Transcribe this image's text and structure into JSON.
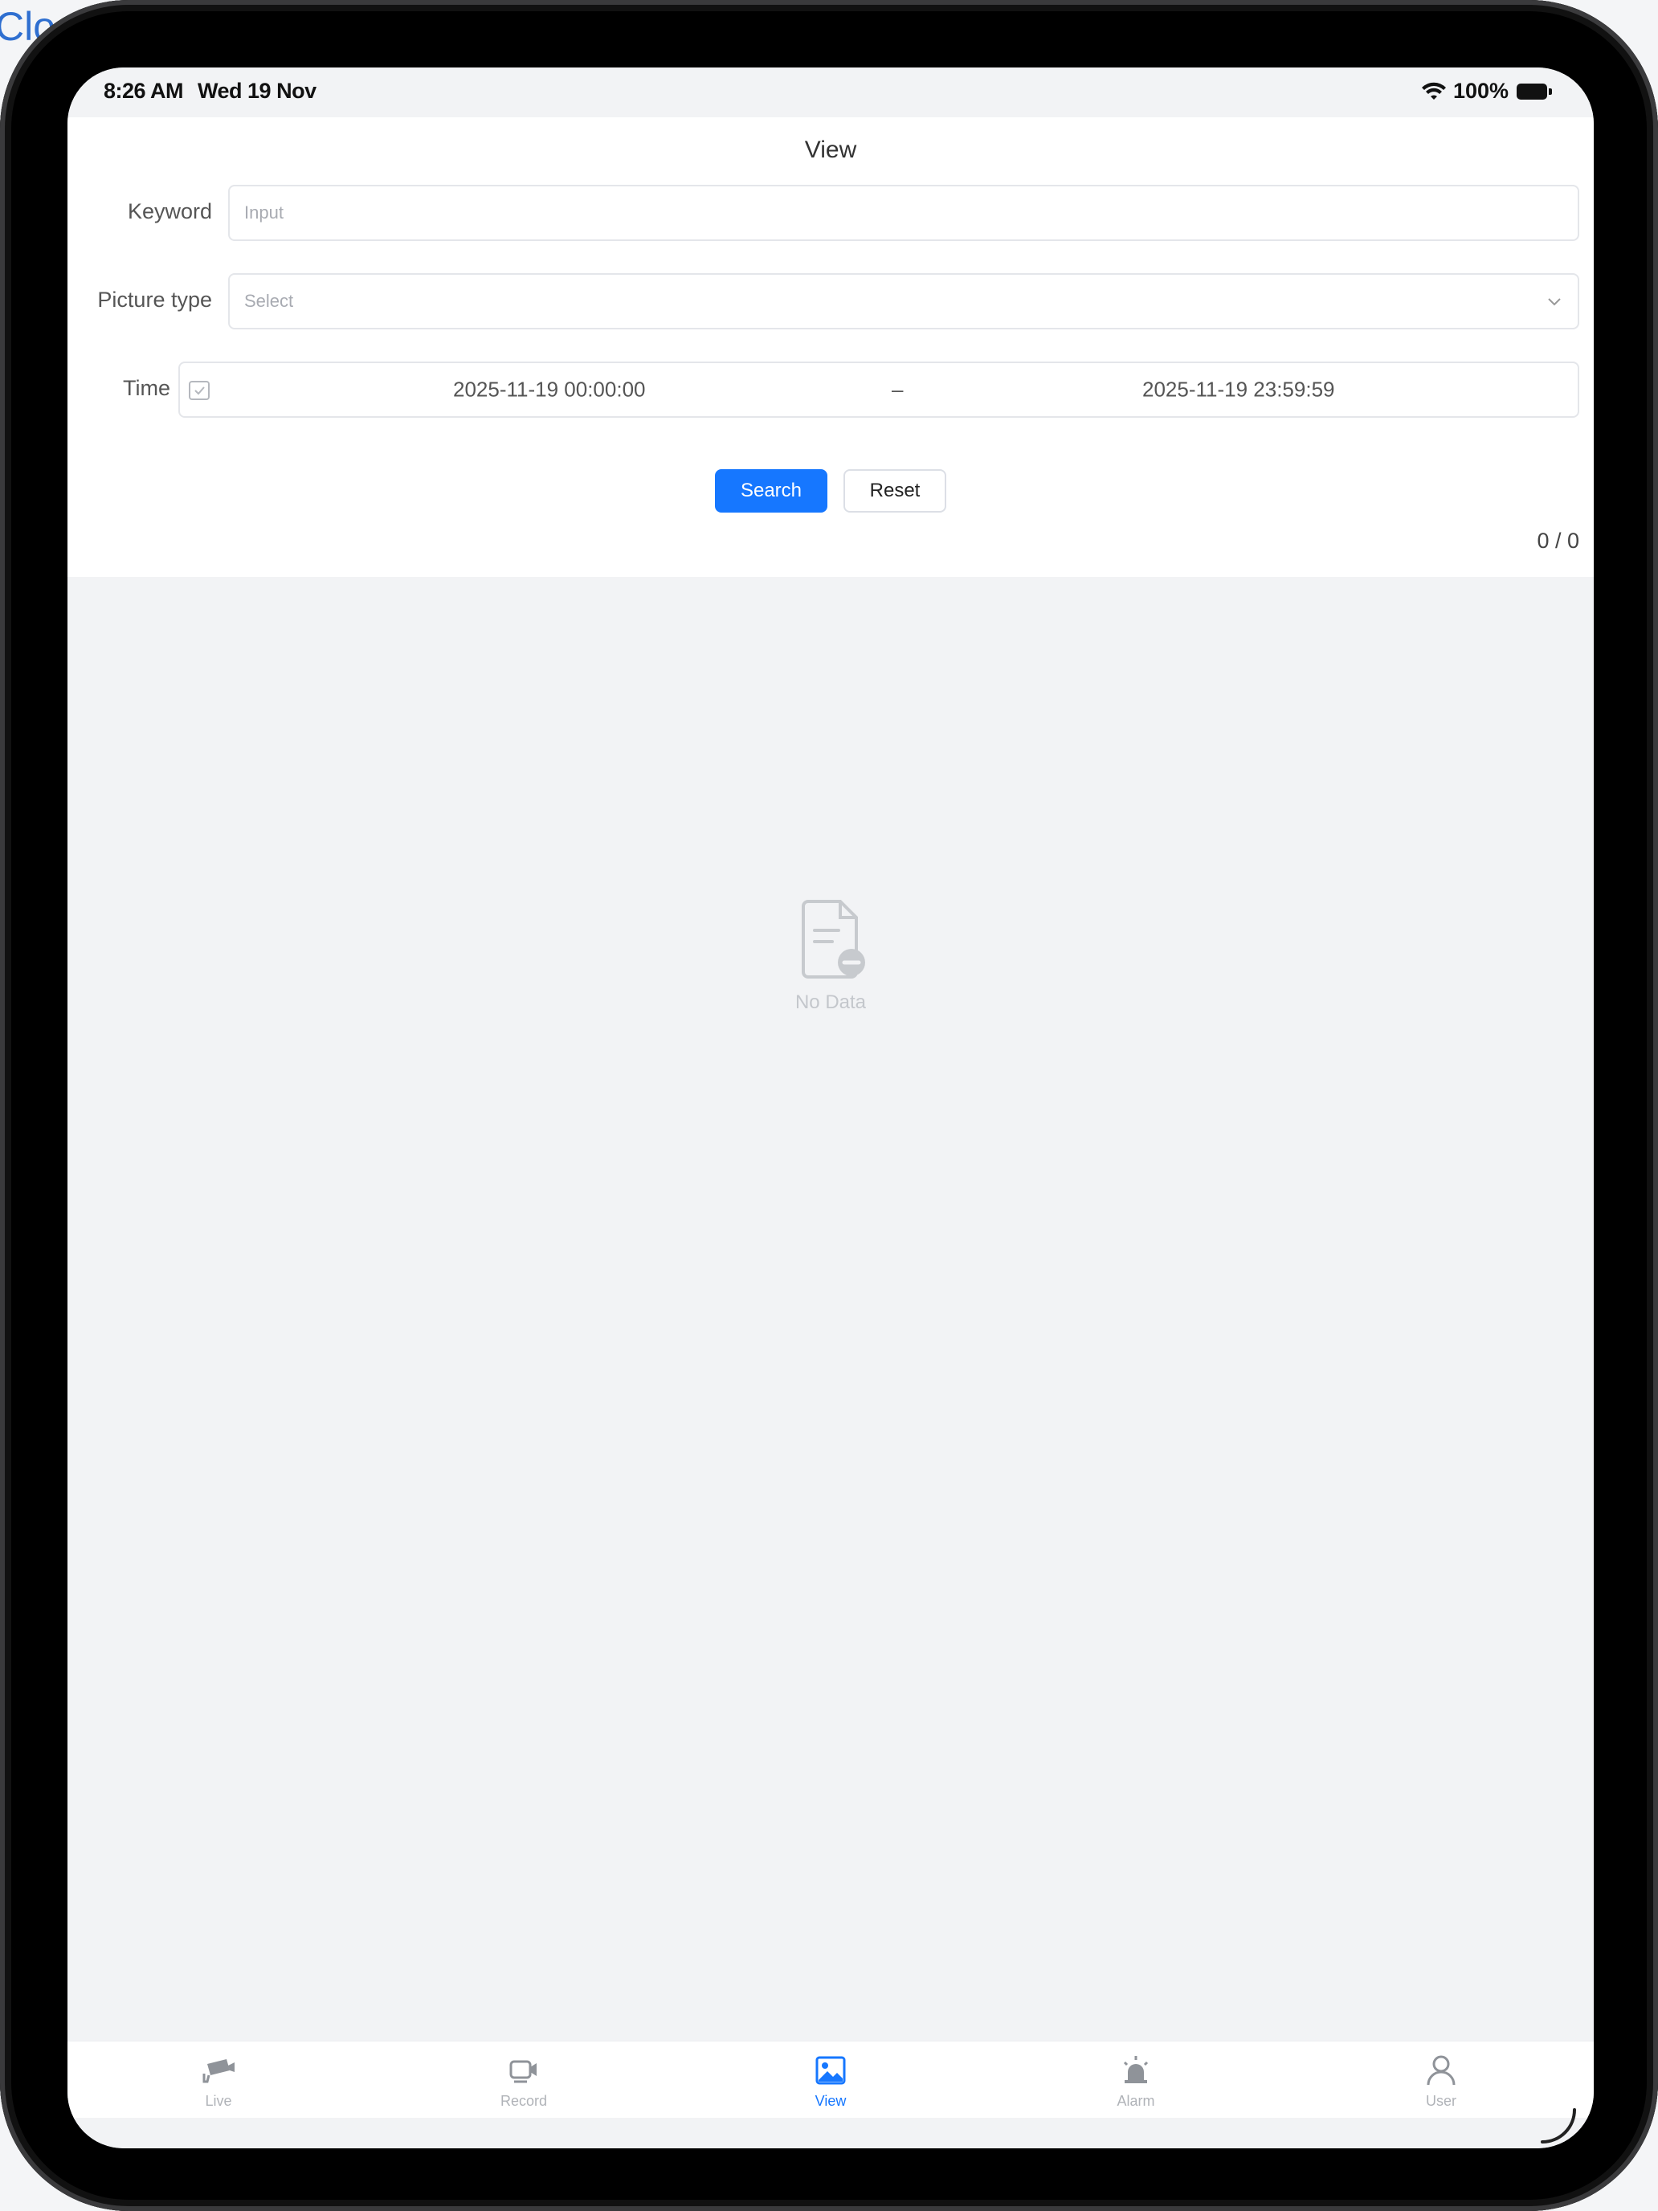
{
  "background_peek_text": "Clo",
  "status_bar": {
    "time": "8:26 AM",
    "date": "Wed 19 Nov",
    "battery": "100%"
  },
  "page": {
    "title": "View"
  },
  "form": {
    "keyword_label": "Keyword",
    "keyword_placeholder": "Input",
    "picture_type_label": "Picture type",
    "picture_type_placeholder": "Select",
    "time_label": "Time",
    "time_start": "2025-11-19 00:00:00",
    "time_separator": "–",
    "time_end": "2025-11-19 23:59:59",
    "search_label": "Search",
    "reset_label": "Reset"
  },
  "pager": {
    "text": "0 / 0"
  },
  "empty_state": {
    "text": "No Data",
    "icon": "document-empty-icon"
  },
  "tabbar": {
    "active": "View",
    "accent_color": "#1677ff",
    "tabs": [
      {
        "label": "Live",
        "icon": "camera-icon"
      },
      {
        "label": "Record",
        "icon": "video-record-icon"
      },
      {
        "label": "View",
        "icon": "image-icon"
      },
      {
        "label": "Alarm",
        "icon": "siren-icon"
      },
      {
        "label": "User",
        "icon": "user-icon"
      }
    ]
  }
}
